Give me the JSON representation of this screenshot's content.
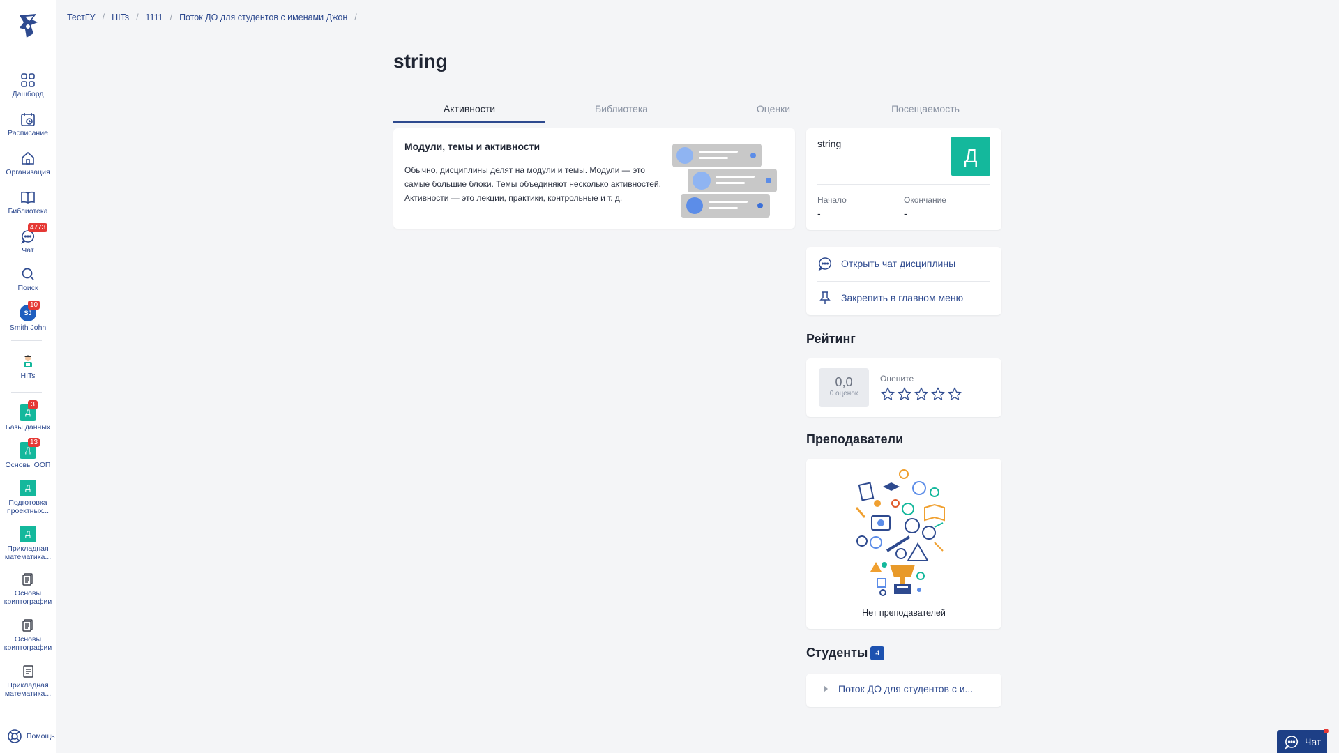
{
  "sidebar": {
    "items": [
      {
        "label": "Дашборд",
        "icon": "dashboard-icon"
      },
      {
        "label": "Расписание",
        "icon": "calendar-icon"
      },
      {
        "label": "Организация",
        "icon": "home-icon"
      },
      {
        "label": "Библиотека",
        "icon": "book-icon"
      },
      {
        "label": "Чат",
        "icon": "chat-icon",
        "badge": "4773"
      },
      {
        "label": "Поиск",
        "icon": "search-icon"
      },
      {
        "label": "Smith John",
        "avatar": "SJ",
        "badge": "10"
      }
    ],
    "orgs": [
      {
        "label": "HITs",
        "icon": "mascot-icon"
      }
    ],
    "courses": [
      {
        "label": "Базы данных",
        "letter": "Д",
        "badge": "3"
      },
      {
        "label": "Основы ООП",
        "letter": "Д",
        "badge": "13"
      },
      {
        "label": "Подготовка проектных...",
        "letter": "Д"
      },
      {
        "label": "Прикладная математика...",
        "letter": "Д"
      },
      {
        "label": "Основы криптографии",
        "icon": "document-icon"
      },
      {
        "label": "Основы криптографии",
        "icon": "document-icon"
      },
      {
        "label": "Прикладная математика...",
        "icon": "document-icon"
      }
    ],
    "help": "Помощь"
  },
  "breadcrumb": [
    "ТестГУ",
    "HITs",
    "1111",
    "Поток ДО для студентов с именами Джон"
  ],
  "page": {
    "title": "string"
  },
  "tabs": [
    {
      "label": "Активности",
      "active": true
    },
    {
      "label": "Библиотека",
      "active": false
    },
    {
      "label": "Оценки",
      "active": false
    },
    {
      "label": "Посещаемость",
      "active": false
    }
  ],
  "info": {
    "title": "Модули, темы и активности",
    "text": "Обычно, дисциплины делят на модули и темы. Модули — это самые большие блоки. Темы объединяют несколько активностей. Активности — это лекции, практики, контрольные и т. д."
  },
  "discipline": {
    "name": "string",
    "letter": "Д",
    "start_label": "Начало",
    "start_value": "-",
    "end_label": "Окончание",
    "end_value": "-"
  },
  "actions": {
    "open_chat": "Открыть чат дисциплины",
    "pin": "Закрепить в главном меню"
  },
  "rating": {
    "title": "Рейтинг",
    "score": "0,0",
    "count": "0 оценок",
    "rate_label": "Оцените",
    "stars": 5
  },
  "teachers": {
    "title": "Преподаватели",
    "empty": "Нет преподавателей"
  },
  "students": {
    "title": "Студенты",
    "count": "4",
    "stream": "Поток ДО для студентов с и..."
  },
  "chat_button": {
    "label": "Чат"
  },
  "colors": {
    "accent": "#2e4a8f",
    "course": "#14b89c",
    "badge": "#e53935",
    "chat": "#1d3f86"
  }
}
